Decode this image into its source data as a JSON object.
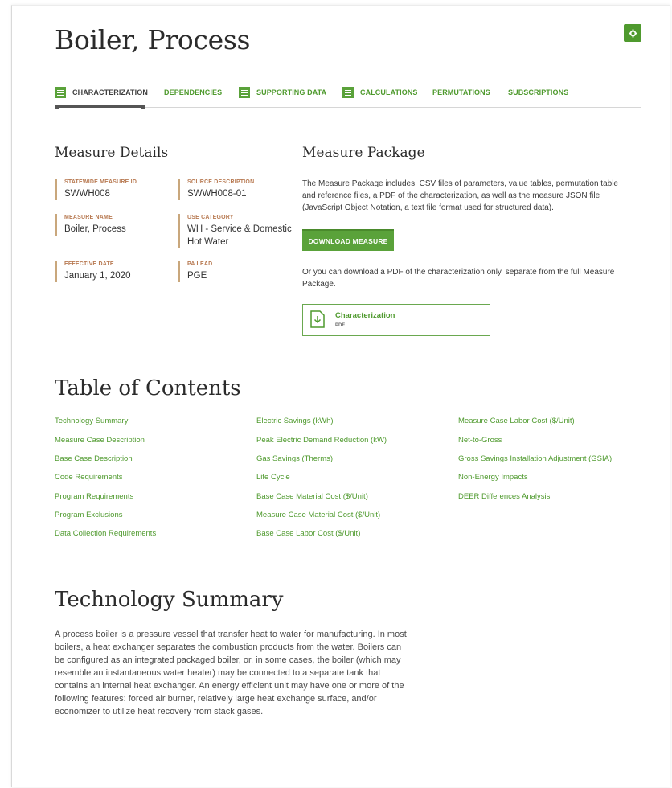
{
  "page": {
    "title": "Boiler, Process"
  },
  "tabs": [
    {
      "label": "CHARACTERIZATION",
      "active": true,
      "icon": "list-icon"
    },
    {
      "label": "DEPENDENCIES",
      "active": false,
      "icon": ""
    },
    {
      "label": "SUPPORTING DATA",
      "active": false,
      "icon": "list-icon"
    },
    {
      "label": "CALCULATIONS",
      "active": false,
      "icon": "list-icon"
    },
    {
      "label": "PERMUTATIONS",
      "active": false,
      "icon": ""
    },
    {
      "label": "SUBSCRIPTIONS",
      "active": false,
      "icon": ""
    }
  ],
  "measure_details": {
    "heading": "Measure Details",
    "fields": [
      {
        "label": "STATEWIDE MEASURE ID",
        "value": "SWWH008"
      },
      {
        "label": "SOURCE DESCRIPTION",
        "value": "SWWH008-01"
      },
      {
        "label": "MEASURE NAME",
        "value": "Boiler, Process"
      },
      {
        "label": "USE CATEGORY",
        "value": "WH - Service & Domestic Hot Water"
      },
      {
        "label": "EFFECTIVE DATE",
        "value": "January 1, 2020"
      },
      {
        "label": "PA LEAD",
        "value": "PGE"
      }
    ]
  },
  "measure_package": {
    "heading": "Measure Package",
    "intro": "The Measure Package includes: CSV files of parameters, value tables, permutation table and reference files, a PDF of the characterization, as well as the measure JSON file (JavaScript Object Notation, a text file format used for structured data).",
    "download_label": "DOWNLOAD MEASURE",
    "alt_text": "Or you can download a PDF of the characterization only, separate from the full Measure Package.",
    "file_name": "Characterization",
    "file_type": "PDF"
  },
  "toc": {
    "heading": "Table of Contents",
    "columns": [
      [
        "Technology Summary",
        "Measure Case Description",
        "Base Case Description",
        "Code Requirements",
        "Program Requirements",
        "Program Exclusions",
        "Data Collection Requirements"
      ],
      [
        "Electric Savings (kWh)",
        "Peak Electric Demand Reduction (kW)",
        "Gas Savings (Therms)",
        "Life Cycle",
        "Base Case Material Cost ($/Unit)",
        "Measure Case Material Cost ($/Unit)",
        "Base Case Labor Cost ($/Unit)"
      ],
      [
        "Measure Case Labor Cost ($/Unit)",
        "Net-to-Gross",
        "Gross Savings Installation Adjustment (GSIA)",
        "Non-Energy Impacts",
        "DEER Differences Analysis"
      ]
    ]
  },
  "technology_summary": {
    "heading": "Technology Summary",
    "text": "A process boiler is a pressure vessel that transfer heat to water for manufacturing. In most boilers, a heat exchanger separates the combustion products from the water. Boilers can be configured as an integrated packaged boiler, or, in some cases, the boiler (which may resemble an instantaneous water heater) may be connected to a separate tank that contains an internal heat exchanger. An energy efficient unit may have one or more of the following features: forced air burner, relatively large heat exchange surface, and/or economizer to utilize heat recovery from stack gases."
  },
  "colors": {
    "brand_green": "#5aa23a",
    "link_green": "#4f9a2e",
    "label_tan": "#b87a52"
  }
}
